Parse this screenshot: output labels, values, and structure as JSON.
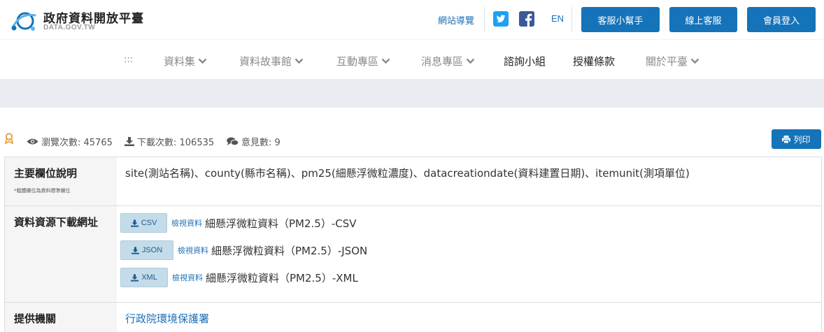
{
  "header": {
    "site_name": "政府資料開放平臺",
    "site_sub": "DATA.GOV.TW",
    "sitemap_label": "網站導覽",
    "lang_label": "EN",
    "buttons": [
      "客服小幫手",
      "線上客服",
      "會員登入"
    ]
  },
  "nav": {
    "menu_glyph": ":::",
    "items": [
      "資料集",
      "資料故事館",
      "互動專區",
      "消息專區",
      "諮詢小組",
      "授權條款",
      "關於平臺"
    ]
  },
  "stats": {
    "views": "瀏覽次數: 45765",
    "downloads": "下載次數: 106535",
    "comments": "意見數: 9",
    "print_label": "列印"
  },
  "table": {
    "fields_head": "主要欄位說明",
    "fields_note": "*粗體欄位為資料標準欄位",
    "fields_value": "site(測站名稱)、county(縣市名稱)、pm25(細懸浮微粒濃度)、datacreationdate(資料建置日期)、itemunit(測項單位)",
    "download_head": "資料資源下載網址",
    "downloads": [
      {
        "format": "CSV",
        "view": "檢視資料",
        "name": "細懸浮微粒資料（PM2.5）-CSV"
      },
      {
        "format": "JSON",
        "view": "檢視資料",
        "name": "細懸浮微粒資料（PM2.5）-JSON"
      },
      {
        "format": "XML",
        "view": "檢視資料",
        "name": "細懸浮微粒資料（PM2.5）-XML"
      }
    ],
    "provider_head": "提供機關",
    "provider_value": "行政院環境保護署"
  },
  "colors": {
    "primary": "#1473b9",
    "link": "#1d6fb5",
    "band": "#e9ecf1",
    "facebook": "#3b5998",
    "twitter": "#1da1f2",
    "badge": "#e8a13a"
  },
  "icons": {
    "logo": "platform-logo",
    "views": "eye-icon",
    "downloads": "download-icon",
    "comments": "comments-icon",
    "print": "print-icon",
    "badge": "award-badge-icon"
  }
}
